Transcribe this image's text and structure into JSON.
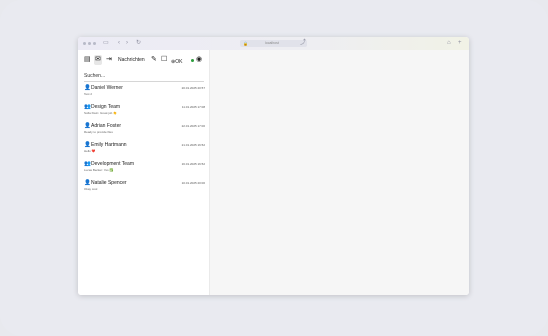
{
  "browser": {
    "url": "localhost"
  },
  "toolbar": {
    "nav_label": "Nachrichten",
    "status_text": "OK"
  },
  "search": {
    "placeholder": "Suchen..."
  },
  "chats": [
    {
      "type": "person",
      "name": "Daniel Werner",
      "time": "20.01.2025 20:57",
      "message": "Test 2"
    },
    {
      "type": "group",
      "name": "Design Team",
      "time": "11.01.2025 17:08",
      "message": "Sofia Klein: Great job 👏"
    },
    {
      "type": "person",
      "name": "Adrian Foster",
      "time": "22.01.2025 17:00",
      "message": "Ready to provide files"
    },
    {
      "type": "person",
      "name": "Emily Hartmann",
      "time": "21.01.2025 16:52",
      "message": "Hello ❤️"
    },
    {
      "type": "group",
      "name": "Development Team",
      "time": "16.01.2025 16:52",
      "message": "Lucas Becker: Yes ✅"
    },
    {
      "type": "person",
      "name": "Natalie Spencer",
      "time": "10.01.2025 20:00",
      "message": "Okay cool"
    }
  ]
}
